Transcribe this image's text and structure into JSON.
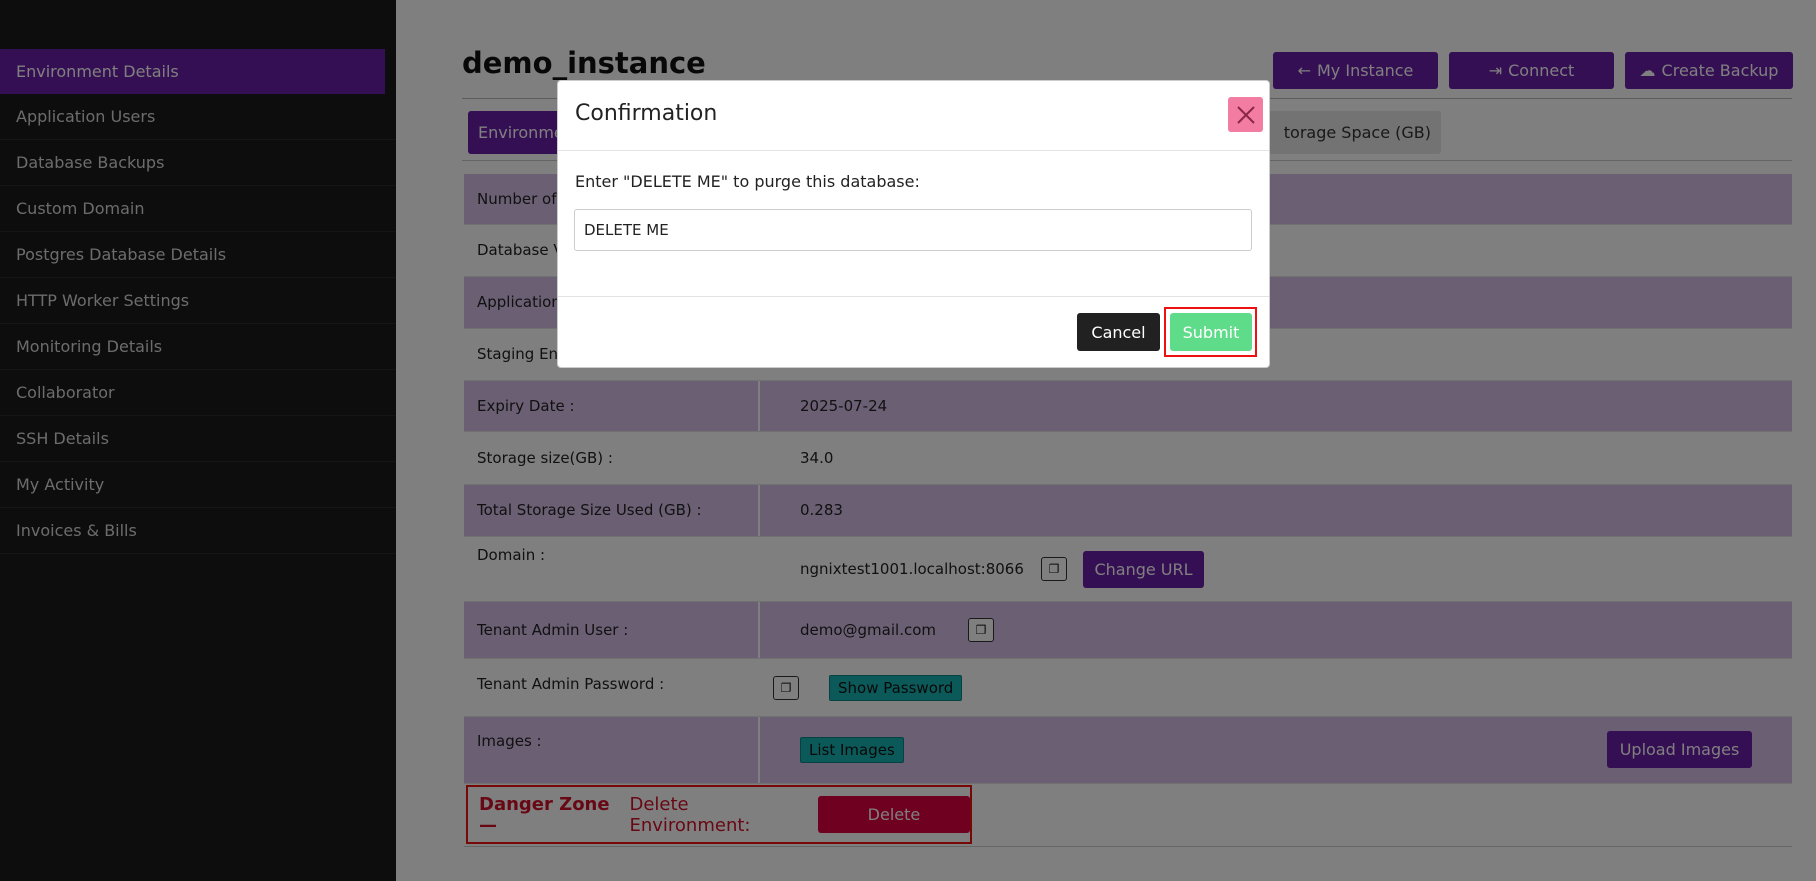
{
  "sidebar": {
    "items": [
      {
        "label": "Environment Details"
      },
      {
        "label": "Application Users"
      },
      {
        "label": "Database Backups"
      },
      {
        "label": "Custom Domain"
      },
      {
        "label": "Postgres Database Details"
      },
      {
        "label": "HTTP Worker Settings"
      },
      {
        "label": "Monitoring Details"
      },
      {
        "label": "Collaborator"
      },
      {
        "label": "SSH Details"
      },
      {
        "label": "My Activity"
      },
      {
        "label": "Invoices & Bills"
      }
    ]
  },
  "header": {
    "title": "demo_instance",
    "buttons": {
      "my_instance": "My Instance",
      "connect": "Connect",
      "create_backup": "Create Backup"
    }
  },
  "tabs": {
    "active_partial": "Environme",
    "storage_partial": "torage Space (GB)"
  },
  "details": {
    "rows": [
      {
        "label": "Number of",
        "value": ""
      },
      {
        "label": "Database V",
        "value": ""
      },
      {
        "label": "Application",
        "value": ""
      },
      {
        "label": "Staging Env",
        "value": ""
      },
      {
        "label": "Expiry Date :",
        "value": "2025-07-24"
      },
      {
        "label": "Storage size(GB) :",
        "value": "34.0"
      },
      {
        "label": "Total Storage Size Used (GB) :",
        "value": "0.283"
      },
      {
        "label": "Domain :",
        "value": "ngnixtest1001.localhost:8066"
      },
      {
        "label": "Tenant Admin User :",
        "value": "demo@gmail.com"
      },
      {
        "label": "Tenant Admin Password :",
        "value": ""
      },
      {
        "label": "Images :",
        "value": ""
      }
    ],
    "change_url_label": "Change URL",
    "show_password_label": "Show Password",
    "list_images_label": "List Images",
    "upload_images_label": "Upload Images"
  },
  "danger": {
    "title": "Danger Zone —",
    "subtitle": "Delete Environment:",
    "delete_label": "Delete"
  },
  "modal": {
    "title": "Confirmation",
    "prompt": "Enter \"DELETE ME\" to purge this database:",
    "input_value": "DELETE ME",
    "cancel_label": "Cancel",
    "submit_label": "Submit"
  },
  "colors": {
    "accent": "#6a1fa8",
    "danger": "#e00040",
    "submit": "#5fdc8a",
    "teal": "#18b3b3"
  }
}
